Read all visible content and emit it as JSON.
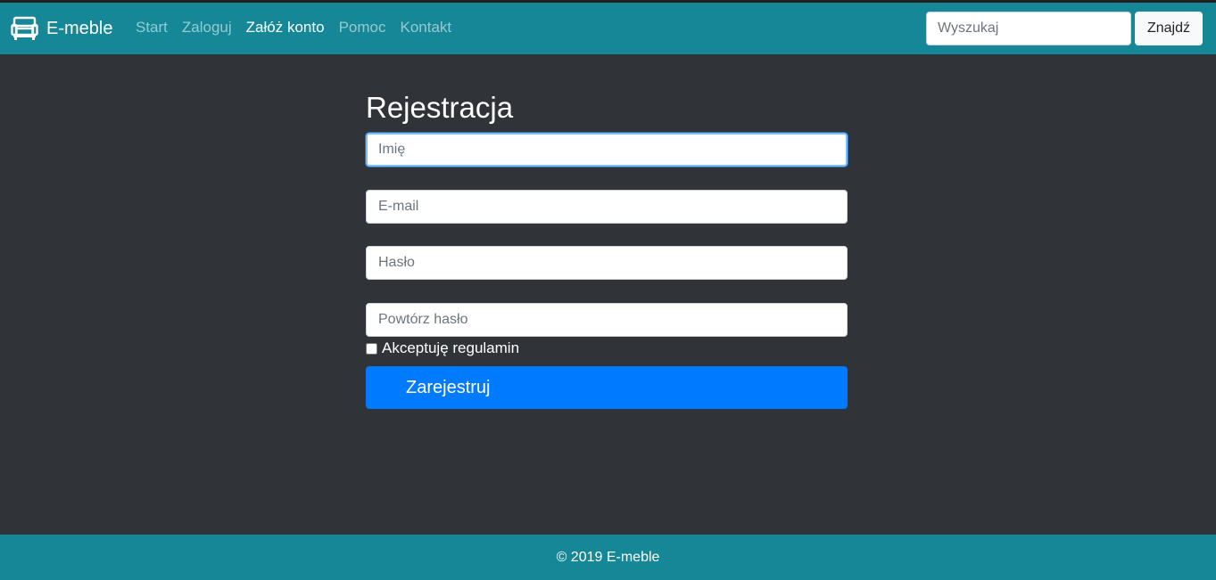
{
  "navbar": {
    "brand_icon": "sofa-icon",
    "brand_name": "E-meble",
    "links": [
      {
        "label": "Start",
        "active": false
      },
      {
        "label": "Zaloguj",
        "active": false
      },
      {
        "label": "Załóż konto",
        "active": true
      },
      {
        "label": "Pomoc",
        "active": false
      },
      {
        "label": "Kontakt",
        "active": false
      }
    ],
    "search": {
      "placeholder": "Wyszukaj",
      "value": "",
      "button_label": "Znajdź"
    }
  },
  "form": {
    "title": "Rejestracja",
    "fields": [
      {
        "name": "name",
        "placeholder": "Imię",
        "value": "",
        "focused": true
      },
      {
        "name": "email",
        "placeholder": "E-mail",
        "value": ""
      },
      {
        "name": "password",
        "placeholder": "Hasło",
        "value": ""
      },
      {
        "name": "password-repeat",
        "placeholder": "Powtórz hasło",
        "value": ""
      }
    ],
    "terms_label": "Akceptuję regulamin",
    "terms_checked": false,
    "submit_label": "Zarejestruj"
  },
  "footer": {
    "text": "© 2019 E-meble"
  },
  "colors": {
    "navbar_bg": "#158797",
    "page_bg": "#303338",
    "primary_button": "#007bff",
    "footer_bg": "#158797"
  }
}
